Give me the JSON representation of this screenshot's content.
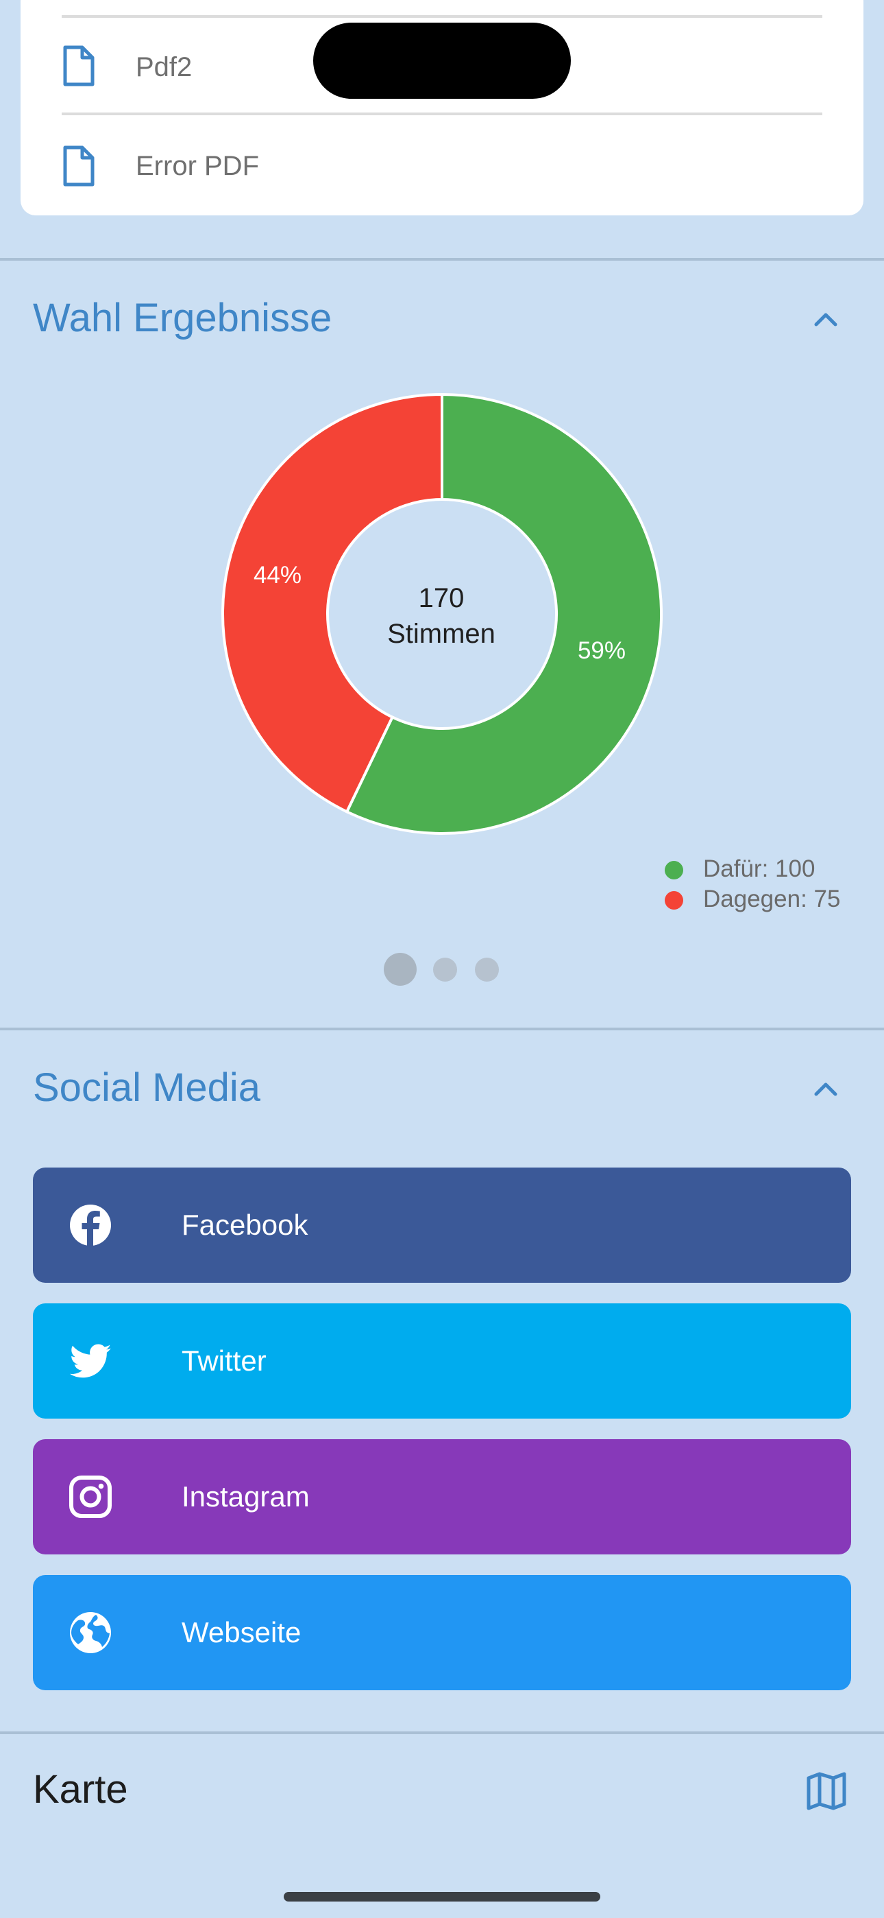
{
  "documents": {
    "items": [
      {
        "label": "Pdf2",
        "icon": "file-icon"
      },
      {
        "label": "Error PDF",
        "icon": "file-icon"
      }
    ]
  },
  "results_section": {
    "title": "Wahl Ergebnisse",
    "center_count": "170",
    "center_unit": "Stimmen",
    "legend": [
      {
        "label": "Dafür: 100",
        "color": "#4caf50"
      },
      {
        "label": "Dagegen: 75",
        "color": "#f44336"
      }
    ],
    "page_indicator": {
      "count": 3,
      "active": 1
    }
  },
  "chart_data": {
    "type": "pie",
    "style": "donut",
    "center_text": [
      "170",
      "Stimmen"
    ],
    "slices": [
      {
        "label": "Dafür",
        "value": 100,
        "percent_label": "59%",
        "color": "#4caf50"
      },
      {
        "label": "Dagegen",
        "value": 75,
        "percent_label": "44%",
        "color": "#f44336"
      }
    ],
    "legend_position": "bottom-right"
  },
  "social_section": {
    "title": "Social Media",
    "buttons": [
      {
        "label": "Facebook",
        "icon": "facebook-icon",
        "color": "#3b5998"
      },
      {
        "label": "Twitter",
        "icon": "twitter-icon",
        "color": "#00acee"
      },
      {
        "label": "Instagram",
        "icon": "instagram-icon",
        "color": "#8739b9"
      },
      {
        "label": "Webseite",
        "icon": "globe-icon",
        "color": "#2196f3"
      }
    ]
  },
  "map_section": {
    "title": "Karte",
    "icon": "map-icon"
  },
  "colors": {
    "background": "#cbdff3",
    "accent": "#3f86c7"
  }
}
